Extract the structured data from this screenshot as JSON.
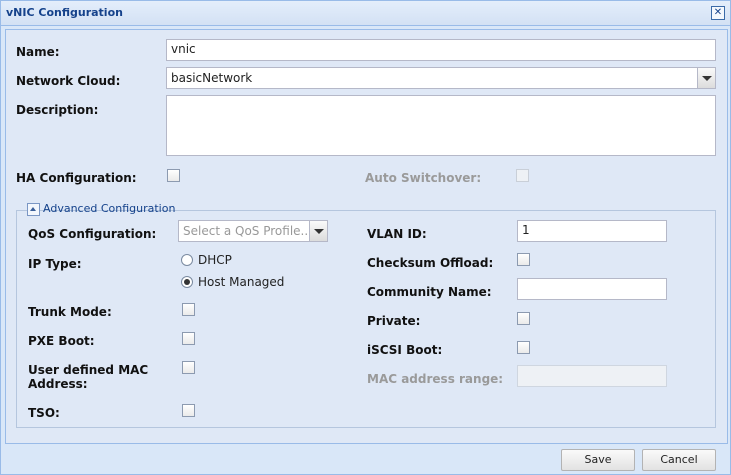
{
  "window": {
    "title": "vNIC Configuration"
  },
  "form": {
    "name": {
      "label": "Name:",
      "value": "vnic"
    },
    "network_cloud": {
      "label": "Network Cloud:",
      "value": "basicNetwork"
    },
    "description": {
      "label": "Description:",
      "value": ""
    },
    "ha_configuration": {
      "label": "HA Configuration:",
      "checked": false
    },
    "auto_switchover": {
      "label": "Auto Switchover:",
      "checked": false,
      "disabled": true
    }
  },
  "advanced": {
    "legend": "Advanced Configuration",
    "qos": {
      "label": "QoS Configuration:",
      "placeholder": "Select a QoS Profile..."
    },
    "ip_type": {
      "label": "IP Type:",
      "options": [
        "DHCP",
        "Host Managed"
      ],
      "selected": "Host Managed"
    },
    "trunk_mode": {
      "label": "Trunk Mode:",
      "checked": false
    },
    "pxe_boot": {
      "label": "PXE Boot:",
      "checked": false
    },
    "user_defined_mac": {
      "label_line1": "User defined MAC",
      "label_line2": "Address:",
      "checked": false
    },
    "tso": {
      "label": "TSO:",
      "checked": false
    },
    "vlan_id": {
      "label": "VLAN ID:",
      "value": "1"
    },
    "checksum_offload": {
      "label": "Checksum Offload:",
      "checked": false
    },
    "community_name": {
      "label": "Community Name:",
      "value": ""
    },
    "private": {
      "label": "Private:",
      "checked": false
    },
    "iscsi_boot": {
      "label": "iSCSI Boot:",
      "checked": false
    },
    "mac_address_range": {
      "label": "MAC address range:",
      "value": "",
      "disabled": true
    }
  },
  "buttons": {
    "save": "Save",
    "cancel": "Cancel"
  }
}
